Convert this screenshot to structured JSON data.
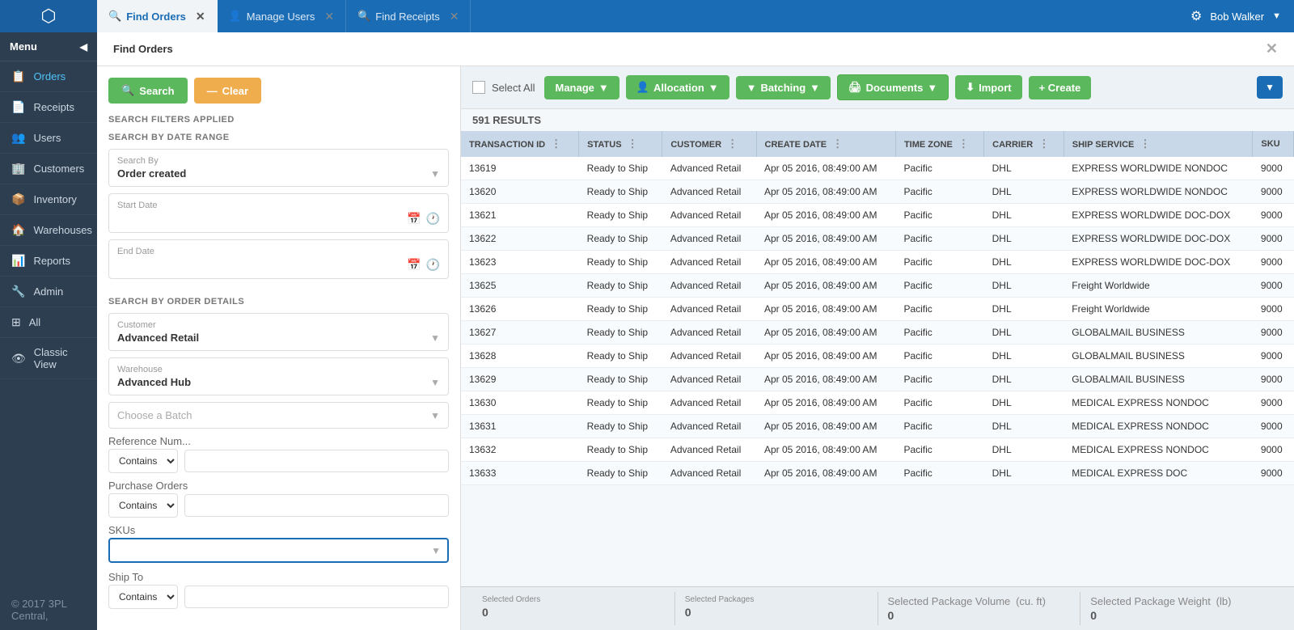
{
  "topbar": {
    "tabs": [
      {
        "id": "find-orders",
        "label": "Find Orders",
        "icon": "🔍",
        "active": true
      },
      {
        "id": "manage-users",
        "label": "Manage Users",
        "icon": "👤",
        "active": false
      },
      {
        "id": "find-receipts",
        "label": "Find Receipts",
        "icon": "🔍",
        "active": false
      }
    ],
    "user": "Bob Walker",
    "gear_label": "⚙"
  },
  "sidebar": {
    "menu_label": "Menu",
    "items": [
      {
        "id": "orders",
        "label": "Orders",
        "icon": "📋",
        "active": false
      },
      {
        "id": "receipts",
        "label": "Receipts",
        "icon": "📄",
        "active": false
      },
      {
        "id": "users",
        "label": "Users",
        "icon": "👥",
        "active": false
      },
      {
        "id": "customers",
        "label": "Customers",
        "icon": "🏢",
        "active": false
      },
      {
        "id": "inventory",
        "label": "Inventory",
        "icon": "📦",
        "active": false
      },
      {
        "id": "warehouses",
        "label": "Warehouses",
        "icon": "🏠",
        "active": false
      },
      {
        "id": "reports",
        "label": "Reports",
        "icon": "📊",
        "active": false
      },
      {
        "id": "admin",
        "label": "Admin",
        "icon": "🔧",
        "active": false
      },
      {
        "id": "all",
        "label": "All",
        "icon": "⊞",
        "active": false
      },
      {
        "id": "classic-view",
        "label": "Classic View",
        "icon": "👁",
        "active": false
      }
    ],
    "copyright": "© 2017 3PL Central,"
  },
  "page_title": "Find Orders",
  "left_panel": {
    "search_btn": "Search",
    "clear_btn": "Clear",
    "filters_label": "SEARCH FILTERS APPLIED",
    "date_range_title": "SEARCH BY DATE RANGE",
    "search_by_label": "Search By",
    "search_by_value": "Order created",
    "start_date_label": "Start Date",
    "start_date_placeholder": "",
    "end_date_label": "End Date",
    "end_date_placeholder": "",
    "order_details_title": "SEARCH BY ORDER DETAILS",
    "customer_label": "Customer",
    "customer_value": "Advanced Retail",
    "warehouse_label": "Warehouse",
    "warehouse_value": "Advanced Hub",
    "batch_label": "Choose a Batch",
    "batch_placeholder": "Choose a Batch",
    "reference_label": "Reference Num...",
    "reference_filter": "Contains",
    "purchase_label": "Purchase Orders",
    "purchase_filter": "Contains",
    "skus_label": "SKUs",
    "ship_to_label": "Ship To",
    "ship_to_filter": "Contains"
  },
  "toolbar": {
    "select_all_label": "Select All",
    "manage_label": "Manage",
    "allocation_label": "Allocation",
    "batching_label": "Batching",
    "documents_label": "Documents",
    "import_label": "Import",
    "create_label": "+ Create",
    "results_count": "591 RESULTS"
  },
  "table": {
    "columns": [
      "TRANSACTION ID",
      "STATUS",
      "CUSTOMER",
      "CREATE DATE",
      "TIME ZONE",
      "CARRIER",
      "SHIP SERVICE",
      "SKU"
    ],
    "rows": [
      {
        "id": "13619",
        "status": "Ready to Ship",
        "customer": "Advanced Retail",
        "create_date": "Apr 05 2016, 08:49:00 AM",
        "timezone": "Pacific",
        "carrier": "DHL",
        "ship_service": "EXPRESS WORLDWIDE NONDOC",
        "sku": "9000"
      },
      {
        "id": "13620",
        "status": "Ready to Ship",
        "customer": "Advanced Retail",
        "create_date": "Apr 05 2016, 08:49:00 AM",
        "timezone": "Pacific",
        "carrier": "DHL",
        "ship_service": "EXPRESS WORLDWIDE NONDOC",
        "sku": "9000"
      },
      {
        "id": "13621",
        "status": "Ready to Ship",
        "customer": "Advanced Retail",
        "create_date": "Apr 05 2016, 08:49:00 AM",
        "timezone": "Pacific",
        "carrier": "DHL",
        "ship_service": "EXPRESS WORLDWIDE DOC-DOX",
        "sku": "9000"
      },
      {
        "id": "13622",
        "status": "Ready to Ship",
        "customer": "Advanced Retail",
        "create_date": "Apr 05 2016, 08:49:00 AM",
        "timezone": "Pacific",
        "carrier": "DHL",
        "ship_service": "EXPRESS WORLDWIDE DOC-DOX",
        "sku": "9000"
      },
      {
        "id": "13623",
        "status": "Ready to Ship",
        "customer": "Advanced Retail",
        "create_date": "Apr 05 2016, 08:49:00 AM",
        "timezone": "Pacific",
        "carrier": "DHL",
        "ship_service": "EXPRESS WORLDWIDE DOC-DOX",
        "sku": "9000"
      },
      {
        "id": "13625",
        "status": "Ready to Ship",
        "customer": "Advanced Retail",
        "create_date": "Apr 05 2016, 08:49:00 AM",
        "timezone": "Pacific",
        "carrier": "DHL",
        "ship_service": "Freight Worldwide",
        "sku": "9000"
      },
      {
        "id": "13626",
        "status": "Ready to Ship",
        "customer": "Advanced Retail",
        "create_date": "Apr 05 2016, 08:49:00 AM",
        "timezone": "Pacific",
        "carrier": "DHL",
        "ship_service": "Freight Worldwide",
        "sku": "9000"
      },
      {
        "id": "13627",
        "status": "Ready to Ship",
        "customer": "Advanced Retail",
        "create_date": "Apr 05 2016, 08:49:00 AM",
        "timezone": "Pacific",
        "carrier": "DHL",
        "ship_service": "GLOBALMAIL BUSINESS",
        "sku": "9000"
      },
      {
        "id": "13628",
        "status": "Ready to Ship",
        "customer": "Advanced Retail",
        "create_date": "Apr 05 2016, 08:49:00 AM",
        "timezone": "Pacific",
        "carrier": "DHL",
        "ship_service": "GLOBALMAIL BUSINESS",
        "sku": "9000"
      },
      {
        "id": "13629",
        "status": "Ready to Ship",
        "customer": "Advanced Retail",
        "create_date": "Apr 05 2016, 08:49:00 AM",
        "timezone": "Pacific",
        "carrier": "DHL",
        "ship_service": "GLOBALMAIL BUSINESS",
        "sku": "9000"
      },
      {
        "id": "13630",
        "status": "Ready to Ship",
        "customer": "Advanced Retail",
        "create_date": "Apr 05 2016, 08:49:00 AM",
        "timezone": "Pacific",
        "carrier": "DHL",
        "ship_service": "MEDICAL EXPRESS NONDOC",
        "sku": "9000"
      },
      {
        "id": "13631",
        "status": "Ready to Ship",
        "customer": "Advanced Retail",
        "create_date": "Apr 05 2016, 08:49:00 AM",
        "timezone": "Pacific",
        "carrier": "DHL",
        "ship_service": "MEDICAL EXPRESS NONDOC",
        "sku": "9000"
      },
      {
        "id": "13632",
        "status": "Ready to Ship",
        "customer": "Advanced Retail",
        "create_date": "Apr 05 2016, 08:49:00 AM",
        "timezone": "Pacific",
        "carrier": "DHL",
        "ship_service": "MEDICAL EXPRESS NONDOC",
        "sku": "9000"
      },
      {
        "id": "13633",
        "status": "Ready to Ship",
        "customer": "Advanced Retail",
        "create_date": "Apr 05 2016, 08:49:00 AM",
        "timezone": "Pacific",
        "carrier": "DHL",
        "ship_service": "MEDICAL EXPRESS DOC",
        "sku": "9000"
      }
    ]
  },
  "bottom_bar": {
    "selected_orders_label": "Selected Orders",
    "selected_orders_value": "0",
    "selected_packages_label": "Selected Packages",
    "selected_packages_value": "0",
    "selected_volume_label": "Selected Package Volume",
    "selected_volume_unit": "(cu. ft)",
    "selected_volume_value": "0",
    "selected_weight_label": "Selected Package Weight",
    "selected_weight_unit": "(lb)",
    "selected_weight_value": "0"
  }
}
